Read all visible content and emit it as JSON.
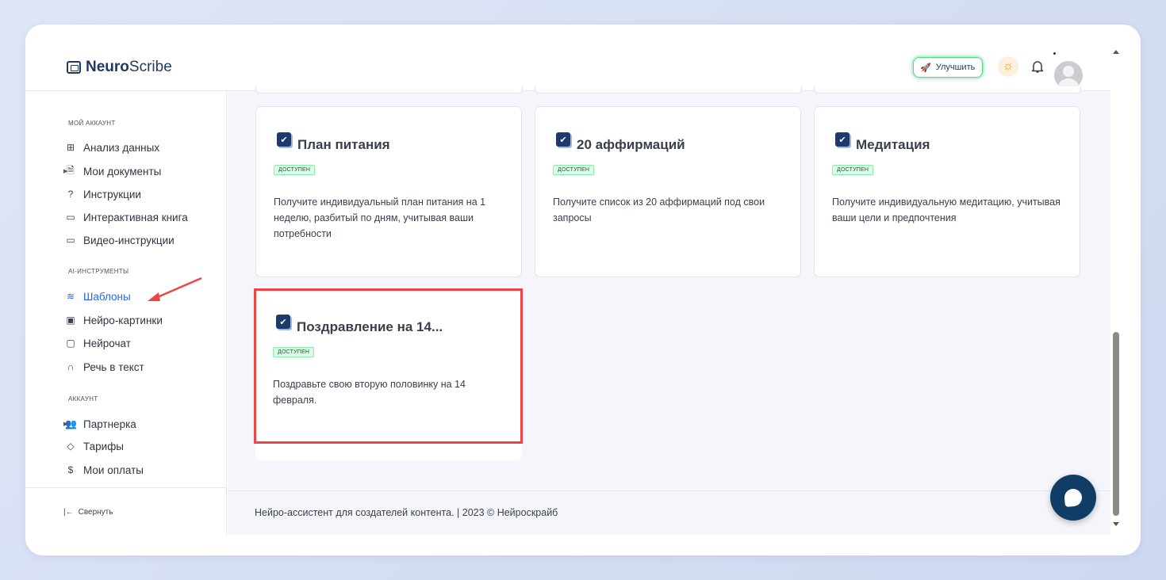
{
  "app": {
    "logo_bold": "Neuro",
    "logo_rest": "Scribe",
    "upgrade_label": "Улучшить",
    "icons": [
      "logo-icon",
      "rocket-icon",
      "sun-icon",
      "bell-icon",
      "avatar"
    ]
  },
  "sidebar": {
    "sections": [
      {
        "title": "мой аккаунт",
        "items": [
          {
            "label": "Анализ данных",
            "icon": "grid-icon"
          },
          {
            "label": "Мои документы",
            "icon": "document-icon",
            "expandable": true
          },
          {
            "label": "Инструкции",
            "icon": "help-icon"
          },
          {
            "label": "Интерактивная книга",
            "icon": "book-icon"
          },
          {
            "label": "Видео-инструкции",
            "icon": "video-icon"
          }
        ]
      },
      {
        "title": "ai-инструменты",
        "items": [
          {
            "label": "Шаблоны",
            "icon": "layers-icon",
            "active": true
          },
          {
            "label": "Нейро-картинки",
            "icon": "image-icon"
          },
          {
            "label": "Нейрочат",
            "icon": "chat-icon"
          },
          {
            "label": "Речь в текст",
            "icon": "headphones-icon"
          }
        ]
      },
      {
        "title": "аккаунт",
        "items": [
          {
            "label": "Партнерка",
            "icon": "users-icon",
            "expandable": true
          },
          {
            "label": "Тарифы",
            "icon": "tag-icon"
          },
          {
            "label": "Мои оплаты",
            "icon": "dollar-icon"
          }
        ]
      }
    ],
    "collapse_label": "Свернуть"
  },
  "cards": [
    {
      "title": "План питания",
      "badge": "доступен",
      "description": "Получите индивидуальный план питания на 1 неделю, разбитый по дням, учитывая ваши потребности"
    },
    {
      "title": "20 аффирмаций",
      "badge": "доступен",
      "description": "Получите список из 20 аффирмаций под свои запросы"
    },
    {
      "title": "Медитация",
      "badge": "доступен",
      "description": "Получите индивидуальную медитацию, учитывая ваши цели и предпочтения"
    },
    {
      "title": "Поздравление на 14...",
      "badge": "доступен",
      "description": "Поздравьте свою вторую половинку на 14 февраля."
    }
  ],
  "footer": {
    "text": "Нейро-ассистент для создателей контента.  | 2023 © Нейроскрайб"
  },
  "colors": {
    "accent": "#2563eb",
    "brand_dark": "#1e3a6b",
    "highlight": "#ef4444",
    "badge_bg": "#dcfce7",
    "chat_button": "#0f3d66"
  }
}
